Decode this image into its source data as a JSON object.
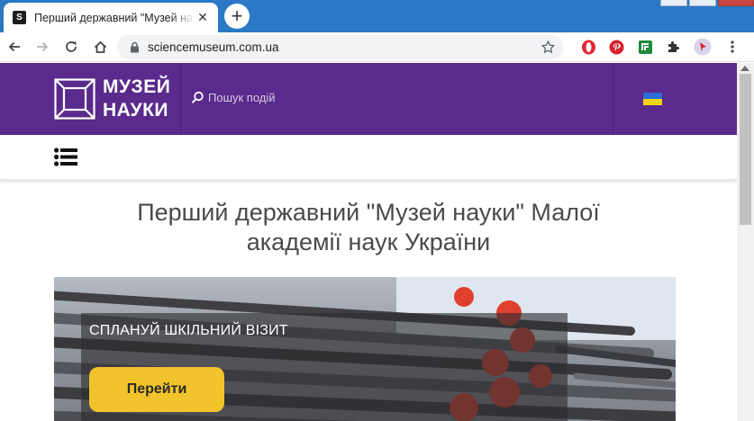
{
  "browser": {
    "tab": {
      "favicon_letter": "S",
      "title": "Перший державний \"Музей нау",
      "close_glyph": "✕"
    },
    "new_tab_glyph": "+",
    "url": "sciencemuseum.com.ua"
  },
  "site": {
    "logo": {
      "line1": "МУЗЕЙ",
      "line2": "НАУКИ"
    },
    "search_placeholder": "Пошук подій",
    "flag_colors": [
      "#2b6bd6",
      "#f5d410"
    ],
    "brand_color": "#5a2a8c"
  },
  "page": {
    "title_line1": "Перший державний \"Музей науки\" Малої",
    "title_line2": "академії наук України"
  },
  "hero": {
    "heading": "СПЛАНУЙ ШКІЛЬНИЙ ВІЗИТ",
    "button_label": "Перейти",
    "button_color": "#f2c42b"
  }
}
